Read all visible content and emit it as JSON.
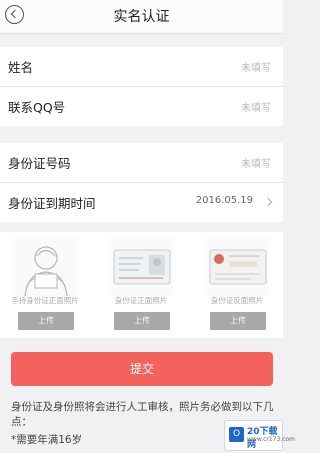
{
  "header": {
    "title": "实名认证"
  },
  "form1": [
    {
      "label": "姓名",
      "value": "未填写"
    },
    {
      "label": "联系QQ号",
      "value": "未填写"
    }
  ],
  "form2": [
    {
      "label": "身份证号码",
      "value": "未填写"
    },
    {
      "label": "身份证到期时间",
      "value": "2016.05.19"
    }
  ],
  "uploads": [
    {
      "caption": "手持身份证正面照片",
      "button": "上传"
    },
    {
      "caption": "身份证正面照片",
      "button": "上传"
    },
    {
      "caption": "身份证反面照片",
      "button": "上传"
    }
  ],
  "submit_label": "提交",
  "notice": "身份证及身份照将会进行人工审核，照片务必做到以下几点：",
  "bullet": "*需要年满16岁",
  "badge": {
    "logo": "O",
    "text": "20下载网",
    "sub": "www.cr173.com"
  },
  "colors": {
    "accent": "#f3625c",
    "badge_blue": "#1d67c8"
  }
}
